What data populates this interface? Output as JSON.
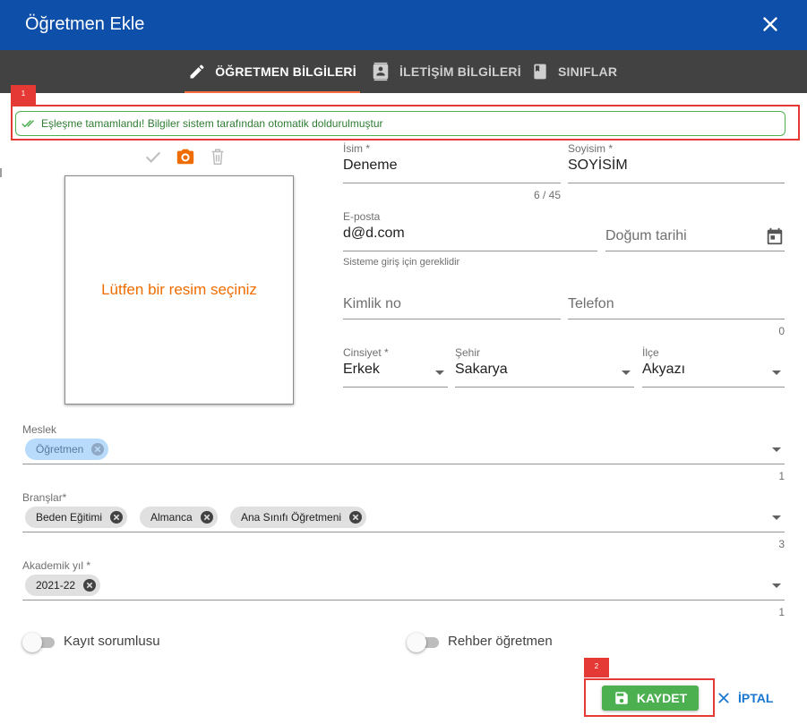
{
  "dialog": {
    "title": "Öğretmen Ekle"
  },
  "tabs": [
    {
      "label": "ÖĞRETMEN BİLGİLERİ",
      "icon": "pencil-icon",
      "active": true
    },
    {
      "label": "İLETİŞİM BİLGİLERİ",
      "icon": "contact-card-icon",
      "active": false
    },
    {
      "label": "SINIFLAR",
      "icon": "book-icon",
      "active": false
    }
  ],
  "markers": {
    "first": "1",
    "second": "2"
  },
  "alert": {
    "text": "Eşleşme tamamlandı! Bilgiler sistem tarafından otomatik doldurulmuştur",
    "color": "#4caf50"
  },
  "photo": {
    "placeholder": "Lütfen bir resim seçiniz",
    "accent": "#ef6c00"
  },
  "form": {
    "isim": {
      "label": "İsim *",
      "value": "Deneme",
      "counter": "6 / 45"
    },
    "soyisim": {
      "label": "Soyisim *",
      "value": "SOYİSİM"
    },
    "eposta": {
      "label": "E-posta",
      "value": "d@d.com",
      "hint": "Sisteme giriş için gereklidir"
    },
    "dogum_tarihi": {
      "placeholder": "Doğum tarihi"
    },
    "kimlik_no": {
      "placeholder": "Kimlik no"
    },
    "telefon": {
      "placeholder": "Telefon",
      "counter": "0"
    },
    "cinsiyet": {
      "label": "Cinsiyet *",
      "value": "Erkek"
    },
    "sehir": {
      "label": "Şehir",
      "value": "Sakarya"
    },
    "ilce": {
      "label": "İlçe",
      "value": "Akyazı"
    },
    "meslek": {
      "label": "Meslek",
      "chips": [
        "Öğretmen"
      ],
      "counter": "1"
    },
    "branslar": {
      "label": "Branşlar*",
      "chips": [
        "Beden Eğitimi",
        "Almanca",
        "Ana Sınıfı Öğretmeni"
      ],
      "counter": "3"
    },
    "akademik_yil": {
      "label": "Akademik yıl *",
      "chips": [
        "2021-22"
      ],
      "counter": "1"
    }
  },
  "switches": {
    "kayit_sorumlusu": "Kayıt sorumlusu",
    "rehber_ogretmen": "Rehber öğretmen"
  },
  "actions": {
    "save": "KAYDET",
    "cancel": "İPTAL"
  },
  "colors": {
    "header": "#0d4fa9",
    "tabs_bg": "#424242",
    "tab_indicator": "#ff6d3f",
    "save": "#4caf50",
    "cancel": "#1976d2",
    "highlight": "#e53935"
  }
}
